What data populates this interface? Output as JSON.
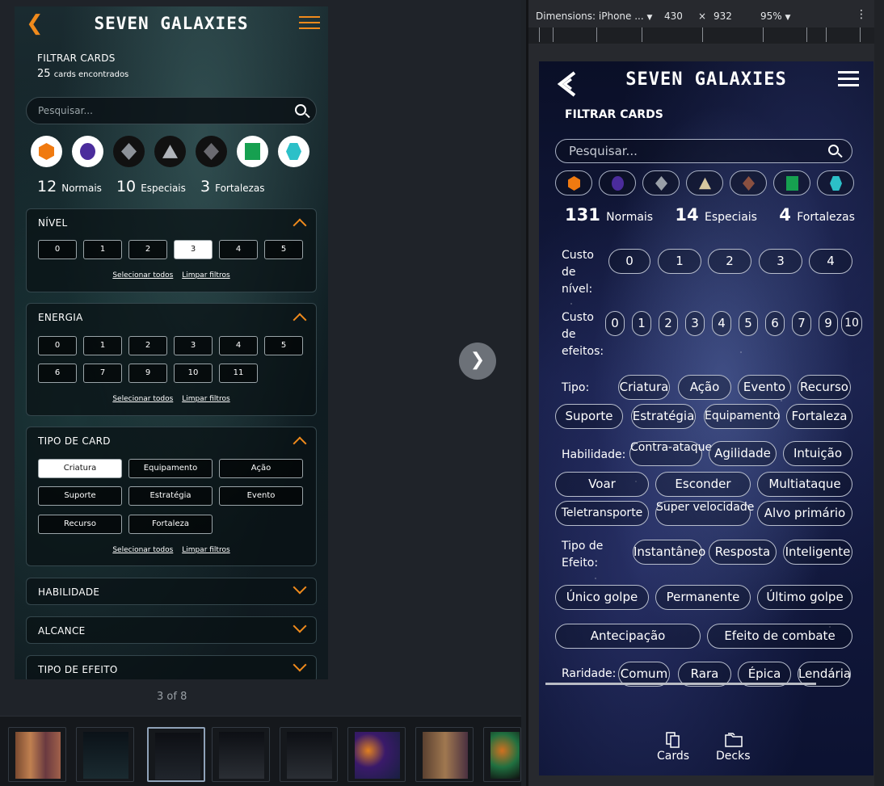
{
  "viewer": {
    "counter": "3 of 8",
    "next_icon": "chevron-right-icon",
    "mockup": {
      "logo": "SEVEN GALAXIES",
      "filter_title": "FILTRAR CARDS",
      "found_count": "25",
      "found_label": "cards encontrados",
      "search_placeholder": "Pesquisar...",
      "counts": [
        {
          "value": "12",
          "label": "Normais"
        },
        {
          "value": "10",
          "label": "Especiais"
        },
        {
          "value": "3",
          "label": "Fortalezas"
        }
      ],
      "nivel": {
        "title": "NÍVEL",
        "options": [
          "0",
          "1",
          "2",
          "3",
          "4",
          "5"
        ],
        "selected": "3"
      },
      "energia": {
        "title": "ENERGIA",
        "options": [
          "0",
          "1",
          "2",
          "3",
          "4",
          "5",
          "6",
          "7",
          "9",
          "10",
          "11"
        ]
      },
      "tipo": {
        "title": "TIPO DE CARD",
        "options": [
          "Criatura",
          "Equipamento",
          "Ação",
          "Suporte",
          "Estratégia",
          "Evento",
          "Recurso",
          "Fortaleza"
        ],
        "selected": "Criatura"
      },
      "select_all": "Selecionar todos",
      "clear": "Limpar filtros",
      "collapsed": [
        "HABILIDADE",
        "ALCANCE",
        "TIPO DE EFEITO"
      ]
    }
  },
  "devtools": {
    "device": "Dimensions: iPhone ...",
    "width": "430",
    "times": "×",
    "height": "932",
    "zoom": "95%"
  },
  "app": {
    "logo": "SEVEN GALAXIES",
    "filter_title": "FILTRAR CARDS",
    "search_placeholder": "Pesquisar...",
    "counts": [
      {
        "value": "131",
        "label": "Normais"
      },
      {
        "value": "14",
        "label": "Especiais"
      },
      {
        "value": "4",
        "label": "Fortalezas"
      }
    ],
    "custo_nivel": {
      "label": "Custo de nível:",
      "options": [
        "0",
        "1",
        "2",
        "3",
        "4"
      ]
    },
    "custo_efeitos": {
      "label": "Custo de efeitos:",
      "options": [
        "0",
        "1",
        "2",
        "3",
        "4",
        "5",
        "6",
        "7",
        "9",
        "10"
      ]
    },
    "tipo": {
      "label": "Tipo:",
      "options": [
        "Criatura",
        "Ação",
        "Evento",
        "Recurso",
        "Suporte",
        "Estratégia",
        "Equipamento",
        "Fortaleza"
      ]
    },
    "habilidade": {
      "label": "Habilidade:",
      "options": [
        "Contra-ataque",
        "Agilidade",
        "Intuição",
        "Voar",
        "Esconder",
        "Multiataque",
        "Teletransporte",
        "Super velocidade",
        "Alvo primário"
      ]
    },
    "tipo_efeito": {
      "label": "Tipo de Efeito:",
      "options": [
        "Instantâneo",
        "Resposta",
        "Inteligente",
        "Único golpe",
        "Permanente",
        "Último golpe",
        "Antecipação",
        "Efeito de combate"
      ]
    },
    "raridade": {
      "label": "Raridade:",
      "options": [
        "Comum",
        "Rara",
        "Épica",
        "Lendária"
      ]
    },
    "nav": [
      {
        "label": "Cards",
        "icon": "cards-icon"
      },
      {
        "label": "Decks",
        "icon": "folder-icon"
      }
    ]
  },
  "colors": {
    "accent": "#f08a1c",
    "gem_orange": "#f07a10",
    "gem_purple": "#4b2c9c",
    "gem_silver": "#9aa0a8",
    "gem_tan": "#d8c8a0",
    "gem_gray": "#6a6a70",
    "gem_green": "#16a050",
    "gem_cyan": "#2cc0c8"
  }
}
